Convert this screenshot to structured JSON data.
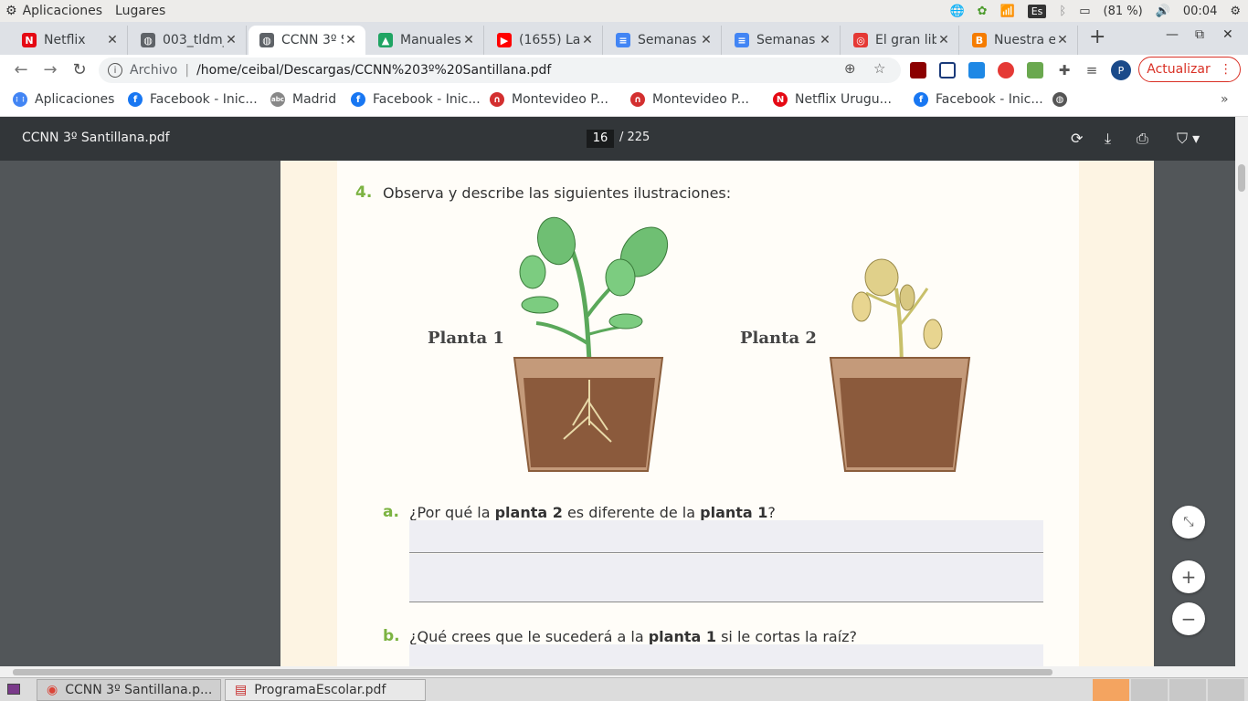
{
  "os_panel": {
    "menu_apps": "Aplicaciones",
    "menu_places": "Lugares",
    "keyboard": "Es",
    "battery": "(81 %)",
    "clock": "00:04"
  },
  "tabs": [
    {
      "title": "Netflix",
      "color": "#e50914",
      "glyph": "N"
    },
    {
      "title": "003_tldm_",
      "color": "#5f6368",
      "glyph": "◍"
    },
    {
      "title": "CCNN 3º S",
      "color": "#5f6368",
      "glyph": "◍"
    },
    {
      "title": "Manuales",
      "color": "#1fa463",
      "glyph": "▲"
    },
    {
      "title": "(1655) La",
      "color": "#ff0000",
      "glyph": "▶"
    },
    {
      "title": "Semanas",
      "color": "#4285f4",
      "glyph": "≡"
    },
    {
      "title": "Semanas",
      "color": "#4285f4",
      "glyph": "≡"
    },
    {
      "title": "El gran lib",
      "color": "#e53935",
      "glyph": "◎"
    },
    {
      "title": "Nuestra e",
      "color": "#f57c00",
      "glyph": "B"
    }
  ],
  "toolbar": {
    "security_label": "Archivo",
    "url": "/home/ceibal/Descargas/CCNN%203º%20Santillana.pdf",
    "update_label": "Actualizar",
    "profile_initial": "P"
  },
  "bookmarks": [
    {
      "label": "Aplicaciones",
      "color": "#4285f4",
      "glyph": "⋮⋮"
    },
    {
      "label": "Facebook - Inic...",
      "color": "#1877f2",
      "glyph": "f"
    },
    {
      "label": "Madrid",
      "color": "#888888",
      "glyph": "abc"
    },
    {
      "label": "Facebook - Inic...",
      "color": "#1877f2",
      "glyph": "f"
    },
    {
      "label": "Montevideo P...",
      "color": "#d32f2f",
      "glyph": "∩"
    },
    {
      "label": "Montevideo P...",
      "color": "#d32f2f",
      "glyph": "∩"
    },
    {
      "label": "Netflix Urugu...",
      "color": "#e50914",
      "glyph": "N"
    },
    {
      "label": "Facebook - Inic...",
      "color": "#1877f2",
      "glyph": "f"
    }
  ],
  "pdf": {
    "filename": "CCNN 3º Santillana.pdf",
    "current_page": "16",
    "total_pages": "/ 225"
  },
  "exercise": {
    "number": "4.",
    "instruction": "Observa y describe las siguientes ilustraciones:",
    "plant1_label": "Planta 1",
    "plant2_label": "Planta 2",
    "q_a_letter": "a.",
    "q_a_pre": "¿Por qué la ",
    "q_a_b1": "planta 2",
    "q_a_mid": " es diferente de la ",
    "q_a_b2": "planta 1",
    "q_a_end": "?",
    "q_b_letter": "b.",
    "q_b_pre": "¿Qué crees que le sucederá a la ",
    "q_b_b1": "planta 1",
    "q_b_end": " si le cortas la raíz?"
  },
  "taskbar": {
    "task1": "CCNN 3º Santillana.p...",
    "task2": "ProgramaEscolar.pdf"
  }
}
